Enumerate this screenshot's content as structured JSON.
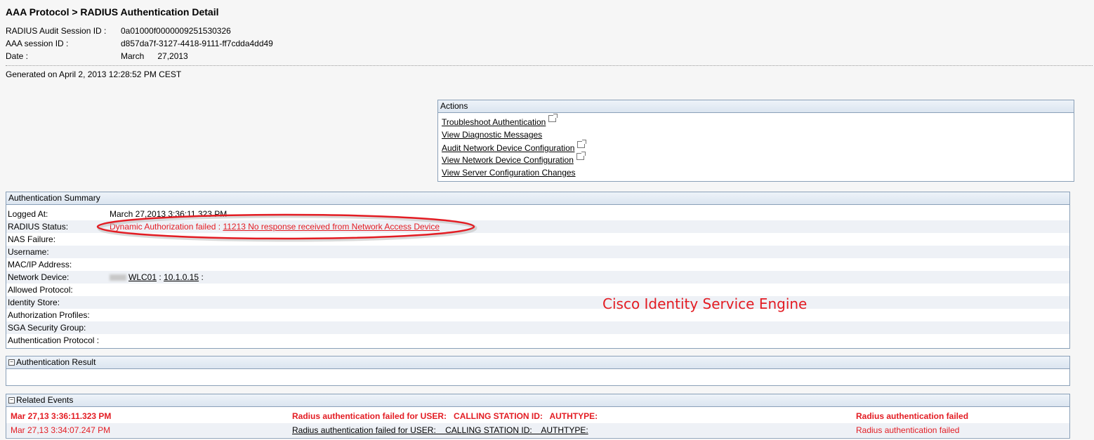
{
  "header": {
    "title": "AAA Protocol > RADIUS Authentication Detail",
    "session_label": "RADIUS Audit Session ID :",
    "session_value": "0a01000f0000009251530326",
    "aaa_label": "AAA session ID :",
    "aaa_value": "d857da7f-3127-4418-9111-ff7cdda4dd49",
    "date_label": "Date :",
    "date_month": "March",
    "date_day_year": "27,2013",
    "generated": "Generated on April 2, 2013 12:28:52 PM CEST"
  },
  "actions": {
    "title": "Actions",
    "links": [
      "Troubleshoot Authentication",
      "View Diagnostic Messages",
      "Audit Network Device Configuration",
      "View Network Device Configuration",
      "View Server Configuration Changes"
    ]
  },
  "summary": {
    "title": "Authentication Summary",
    "logged_at_label": "Logged At:",
    "logged_at_value": "March 27,2013 3:36:11.323 PM",
    "radius_status_label": "RADIUS Status:",
    "radius_status_prefix": "Dynamic Authorization failed :",
    "radius_status_link": "11213 No response received from Network Access Device",
    "nas_failure_label": "NAS Failure:",
    "username_label": "Username:",
    "mac_ip_label": "MAC/IP Address:",
    "network_device_label": "Network Device:",
    "network_device_name": "WLC01",
    "network_device_sep": ":",
    "network_device_ip": "10.1.0.15",
    "network_device_trail": ":",
    "allowed_protocol_label": "Allowed Protocol:",
    "identity_store_label": "Identity Store:",
    "authz_profiles_label": "Authorization Profiles:",
    "sga_label": "SGA Security Group:",
    "auth_protocol_label": "Authentication Protocol :"
  },
  "watermark": "Cisco Identity Service Engine",
  "auth_result": {
    "title": "Authentication Result",
    "toggle": "−"
  },
  "related_events": {
    "title": "Related Events",
    "toggle": "−",
    "rows": [
      {
        "time": "Mar 27,13 3:36:11.323 PM",
        "desc": "Radius authentication failed for USER:   CALLING STATION ID:   AUTHTYPE:",
        "status": "Radius authentication failed"
      },
      {
        "time": "Mar 27,13 3:34:07.247 PM",
        "desc": "Radius authentication failed for USER:    CALLING STATION ID:    AUTHTYPE:",
        "status": "Radius authentication failed"
      }
    ]
  },
  "colors": {
    "error_red": "#e31c23",
    "panel_border": "#8aa0b8",
    "alt_row": "#eef1f6"
  }
}
